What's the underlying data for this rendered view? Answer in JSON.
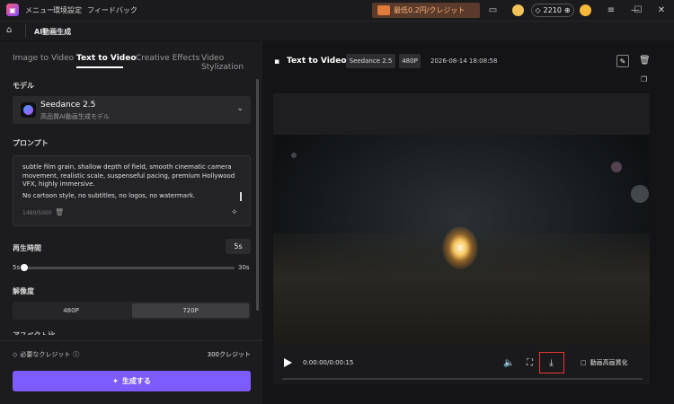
{
  "titlebar": {
    "menu": [
      "メニュー",
      "環境設定",
      "フィードバック"
    ],
    "promo_text": "最低0.2円/クレジット",
    "credits": "2210"
  },
  "nav": {
    "title": "AI動画生成"
  },
  "tabs": [
    "Image to Video",
    "Text to Video",
    "Creative Effects",
    "Video Stylization"
  ],
  "model": {
    "label": "モデル",
    "name": "Seedance 2.5",
    "subtitle": "高品質AI動画生成モデル"
  },
  "prompt": {
    "label": "プロンプト",
    "text": "subtle film grain, shallow depth of field, smooth cinematic camera movement, realistic scale, suspenseful pacing, premium Hollywood VFX, highly immersive.",
    "text2": "No cartoon style, no subtitles, no logos, no watermark.",
    "counter": "1480/5000"
  },
  "duration": {
    "label": "再生時間",
    "value": "5s",
    "min": "5s",
    "max": "30s",
    "fraction": 0
  },
  "resolution": {
    "label": "解像度",
    "options": [
      "480P",
      "720P"
    ],
    "selected": "720P"
  },
  "cut_label": "アスペクト比",
  "footer": {
    "credit_label": "必要なクレジット",
    "credit_value": "300クレジット",
    "generate": "生成する"
  },
  "right": {
    "title": "Text to Video",
    "model_badge": "Seedance 2.5",
    "res_badge": "480P",
    "date": "2026-08-14 18:08:58",
    "time": "0:00:00/0:00:15",
    "upscale": "動画高画質化"
  },
  "colors": {
    "accent": "#7c5cff",
    "highlight": "#e33333"
  }
}
